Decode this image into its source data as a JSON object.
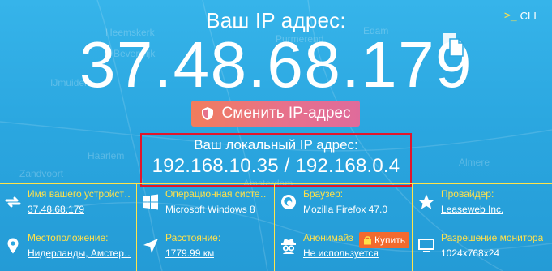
{
  "header": {
    "title": "Ваш IP адрес:",
    "ip": "37.48.68.179",
    "cli_label": "CLI"
  },
  "change_button": {
    "label": "Сменить IP-адрес"
  },
  "local": {
    "label": "Ваш локальный IP адрес:",
    "value": "192.168.10.35 / 192.168.0.4"
  },
  "map_labels": [
    "Heemskerk",
    "Edam",
    "Purmerend",
    "IJmuiden",
    "Beverwijk",
    "Haarlem",
    "Zandvoort",
    "Almere",
    "Amsterdam"
  ],
  "info": {
    "device": {
      "label": "Имя вашего устройст…",
      "value": "37.48.68.179"
    },
    "os": {
      "label": "Операционная систе…",
      "value": "Microsoft Windows 8"
    },
    "browser": {
      "label": "Браузер:",
      "value": "Mozilla Firefox 47.0"
    },
    "provider": {
      "label": "Провайдер:",
      "value": "Leaseweb Inc."
    },
    "location": {
      "label": "Местоположение:",
      "value": "Нидерланды, Амстер…"
    },
    "distance": {
      "label": "Расстояние:",
      "value": "1779.99 км"
    },
    "anonymizer": {
      "label": "Анонимайз",
      "value": "Не используется"
    },
    "resolution": {
      "label": "Разрешение монитора:",
      "value": "1024x768x24"
    }
  },
  "buy_button": {
    "label": "Купить"
  },
  "colors": {
    "accent": "#ffe14a",
    "button": "#e7718b",
    "highlight": "#e0162b",
    "buy": "#f26a2e"
  }
}
